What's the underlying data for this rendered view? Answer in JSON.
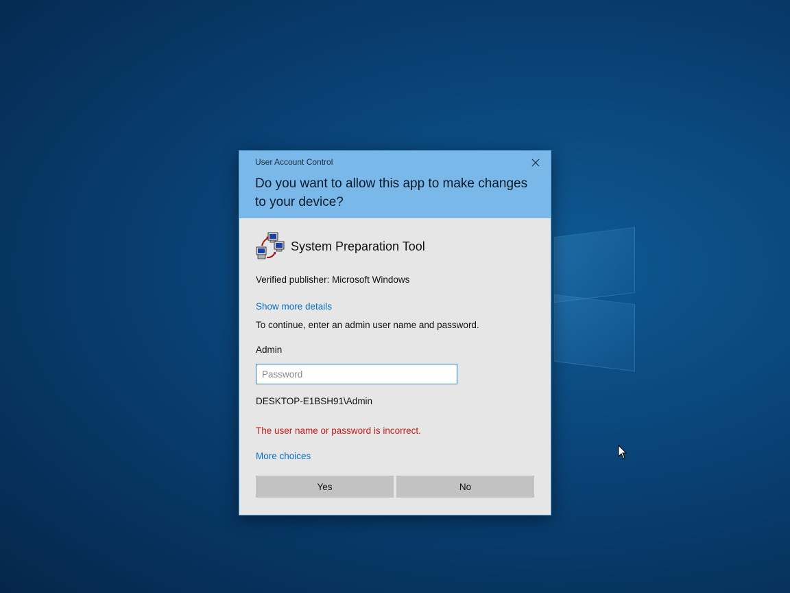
{
  "dialog": {
    "title": "User Account Control",
    "question": "Do you want to allow this app to make changes to your device?",
    "close_icon": "close-icon"
  },
  "app": {
    "icon": "system-preparation-tool-icon",
    "name": "System Preparation Tool",
    "publisher": "Verified publisher: Microsoft Windows"
  },
  "links": {
    "show_more": "Show more details",
    "more_choices": "More choices"
  },
  "credentials": {
    "prompt": "To continue, enter an admin user name and password.",
    "user_name": "Admin",
    "password_placeholder": "Password",
    "password_value": "",
    "account": "DESKTOP-E1BSH91\\Admin",
    "error": "The user name or password is incorrect."
  },
  "buttons": {
    "yes": "Yes",
    "no": "No"
  },
  "colors": {
    "header": "#79b8e8",
    "body": "#e6e6e6",
    "link": "#0a6fc2",
    "error": "#c41a1a",
    "button": "#c2c2c2"
  }
}
